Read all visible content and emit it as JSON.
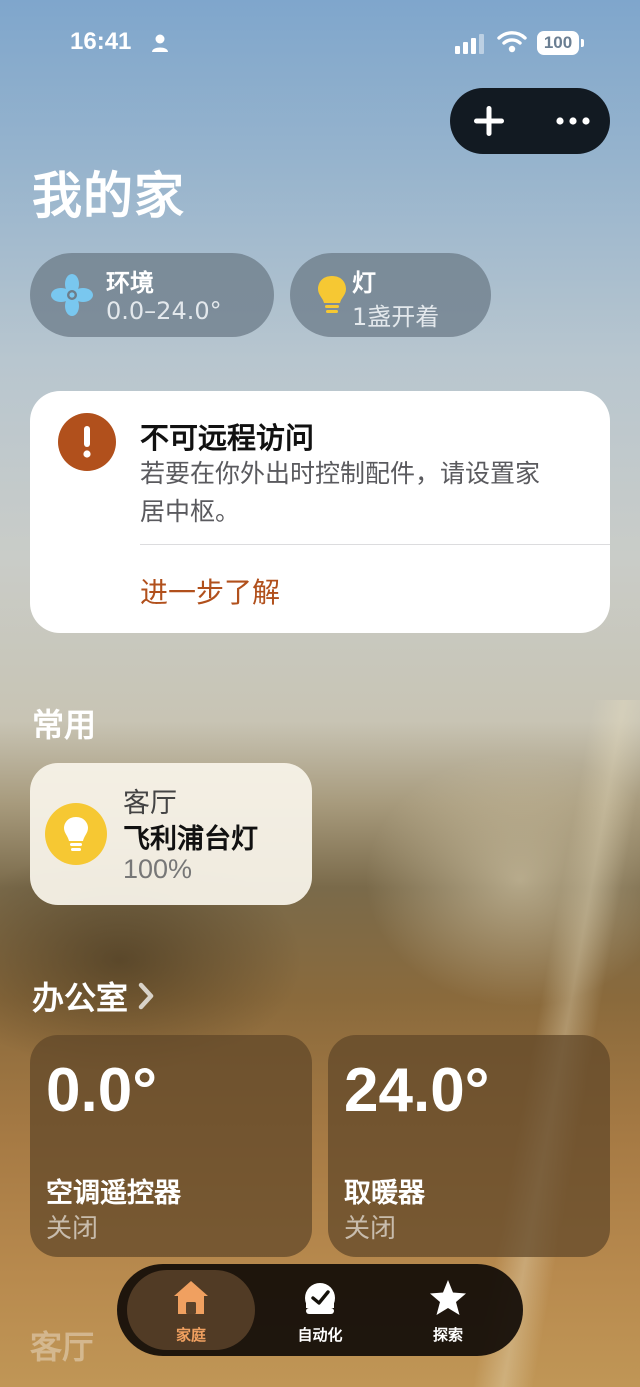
{
  "status_bar": {
    "time": "16:41",
    "battery": "100"
  },
  "header": {
    "title": "我的家"
  },
  "summary": {
    "environment": {
      "title": "环境",
      "value": "0.0–24.0°"
    },
    "lights": {
      "title": "灯",
      "value": "1盏开着"
    }
  },
  "alert": {
    "title": "不可远程访问",
    "message": "若要在你外出时控制配件，请设置家居中枢。",
    "link": "进一步了解"
  },
  "favorites": {
    "title": "常用",
    "items": [
      {
        "room": "客厅",
        "name": "飞利浦台灯",
        "value": "100%"
      }
    ]
  },
  "office": {
    "title": "办公室",
    "tiles": [
      {
        "temp": "0.0°",
        "name": "空调遥控器",
        "state": "关闭"
      },
      {
        "temp": "24.0°",
        "name": "取暖器",
        "state": "关闭"
      }
    ]
  },
  "living_room": {
    "title": "客厅"
  },
  "tabs": [
    {
      "label": "家庭"
    },
    {
      "label": "自动化"
    },
    {
      "label": "探索"
    }
  ],
  "colors": {
    "accent": "#b1501c",
    "tab_active": "#f0a060",
    "bulb": "#f6c833",
    "fan": "#79c7ef"
  }
}
